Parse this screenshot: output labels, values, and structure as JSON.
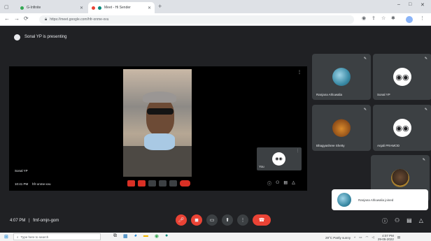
{
  "browser": {
    "tabs": [
      {
        "title": "G-Infinite",
        "active": false
      },
      {
        "title": "Meet - Hi Sender",
        "active": true
      }
    ],
    "new_tab": "+",
    "window_controls": {
      "minimize": "–",
      "maximize": "□",
      "close": "✕"
    },
    "url": "https://meet.google.com/hfr-onme-xvu"
  },
  "meet": {
    "presenting_banner": "Sonal YP is presenting",
    "stage": {
      "presenter_label": "Sonal YP",
      "self_label": "You",
      "time_overlay": "10:41 PM",
      "meeting_overlay": "hfr-onme-xvu"
    },
    "participants": [
      {
        "name": "Ranjana Ahluwalia",
        "avatar": "teal-photo"
      },
      {
        "name": "Sonal YP",
        "avatar": "eyes"
      },
      {
        "name": "Bhagyashree Shetty",
        "avatar": "pumpkin-photo"
      },
      {
        "name": "Anjali PRAMOD",
        "avatar": "eyes"
      },
      {
        "name": "",
        "avatar": "person-photo"
      }
    ],
    "toast": {
      "text": "Ranjana Ahluwalia joined"
    },
    "bottom": {
      "time": "4:07 PM",
      "separator": "|",
      "meeting_code": "fmf-omjn-gom"
    }
  },
  "taskbar": {
    "search_placeholder": "Type here to search",
    "tray_text": "29°C Partly sunny",
    "clock_time": "4:07 PM",
    "clock_date": "29-05-2022"
  },
  "colors": {
    "meet_bg": "#202124",
    "tile_bg": "#3c4043",
    "end_call_red": "#ea4335",
    "chrome_bar": "#dee1e6"
  }
}
